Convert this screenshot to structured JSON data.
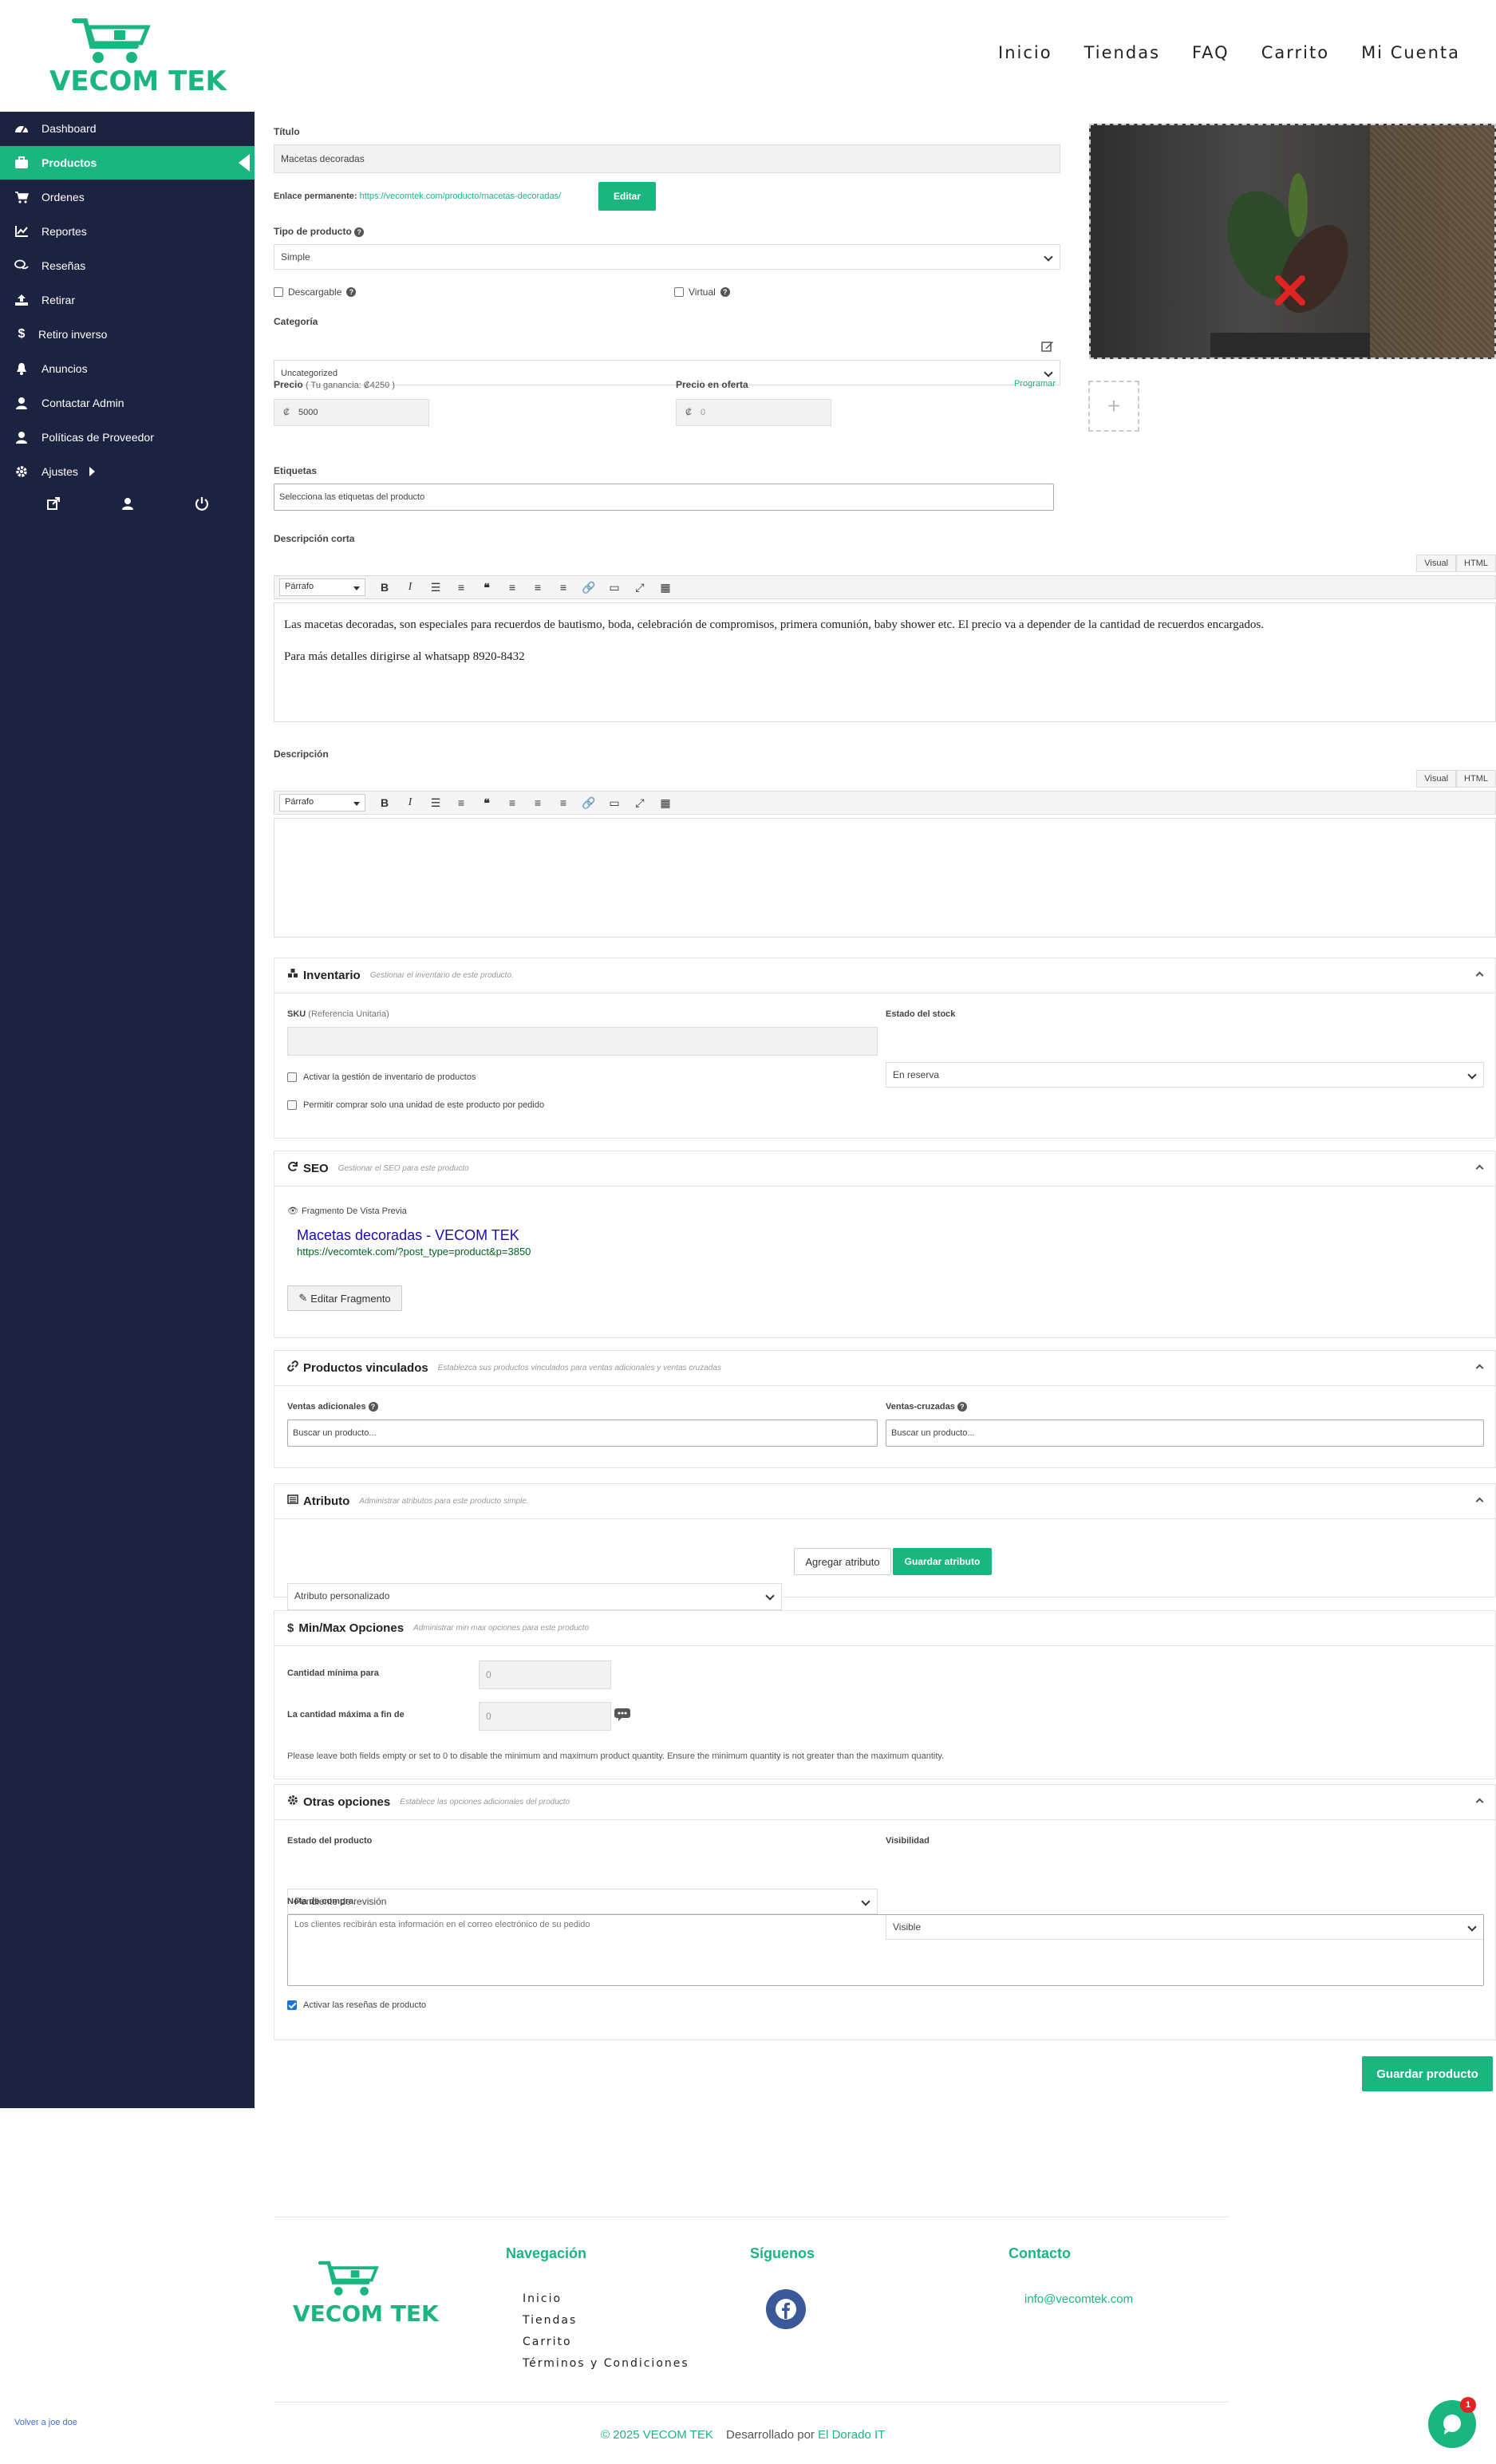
{
  "brand": {
    "name": "VECOM TEK",
    "color": "#1bb67f"
  },
  "topnav": [
    "Inicio",
    "Tiendas",
    "FAQ",
    "Carrito",
    "Mi Cuenta"
  ],
  "sidebar": {
    "items": [
      {
        "label": "Dashboard",
        "icon": "dashboard-icon"
      },
      {
        "label": "Productos",
        "icon": "briefcase-icon"
      },
      {
        "label": "Ordenes",
        "icon": "cart-icon"
      },
      {
        "label": "Reportes",
        "icon": "chart-icon"
      },
      {
        "label": "Reseñas",
        "icon": "comments-icon"
      },
      {
        "label": "Retirar",
        "icon": "upload-icon"
      },
      {
        "label": "Retiro inverso",
        "icon": "dollar-icon"
      },
      {
        "label": "Anuncios",
        "icon": "bell-icon"
      },
      {
        "label": "Contactar Admin",
        "icon": "user-icon"
      },
      {
        "label": "Políticas de Proveedor",
        "icon": "user-icon"
      },
      {
        "label": "Ajustes",
        "icon": "gear-icon"
      }
    ]
  },
  "form": {
    "titulo_label": "Título",
    "titulo_value": "Macetas decoradas",
    "permalink_label": "Enlace permanente:",
    "permalink_url": "https://vecomtek.com/producto/macetas-decoradas/",
    "edit_btn": "Editar",
    "tipo_label": "Tipo de producto",
    "tipo_value": "Simple",
    "descargable": "Descargable",
    "virtual": "Virtual",
    "categoria_label": "Categoría",
    "categoria_value": "Uncategorized",
    "precio_label": "Precio",
    "precio_ganancia": "( Tu ganancia: ₡4250 )",
    "precio_value": "5000",
    "currency": "₡",
    "oferta_label": "Precio en oferta",
    "oferta_placeholder": "0",
    "programar": "Programar",
    "etiquetas_label": "Etiquetas",
    "etiquetas_placeholder": "Selecciona las etiquetas del producto",
    "desc_corta_label": "Descripción corta",
    "desc_corta_p1": "Las macetas decoradas, son especiales para recuerdos de bautismo, boda, celebración de compromisos, primera comunión, baby shower etc. El precio va a depender de la cantidad de recuerdos encargados.",
    "desc_corta_p2": "Para más detalles dirigirse al whatsapp 8920-8432",
    "desc_label": "Descripción",
    "editor_tab_visual": "Visual",
    "editor_tab_html": "HTML",
    "editor_format": "Párrafo"
  },
  "inventario": {
    "title": "Inventario",
    "hint": "Gestionar el inventario de este producto.",
    "sku_label": "SKU",
    "sku_sub": "(Referencia Unitaria)",
    "stock_label": "Estado del stock",
    "stock_value": "En reserva",
    "check1": "Activar la gestión de inventario de productos",
    "check2": "Permitir comprar solo una unidad de este producto por pedido"
  },
  "seo": {
    "title": "SEO",
    "hint": "Gestionar el SEO para este producto",
    "preview_label": "Fragmento De Vista Previa",
    "preview_title": "Macetas decoradas - VECOM TEK",
    "preview_url": "https://vecomtek.com/?post_type=product&p=3850",
    "edit_btn": "Editar Fragmento"
  },
  "vinculados": {
    "title": "Productos vinculados",
    "hint": "Establezca sus productos vinculados para ventas adicionales y ventas cruzadas",
    "upsell_label": "Ventas adicionales",
    "cross_label": "Ventas-cruzadas",
    "placeholder": "Buscar un producto..."
  },
  "atributo": {
    "title": "Atributo",
    "hint": "Administrar atributos para este producto simple.",
    "select_value": "Atributo personalizado",
    "add_btn": "Agregar atributo",
    "save_btn": "Guardar atributo"
  },
  "minmax": {
    "title": "Min/Max Opciones",
    "hint": "Administrar min max opciones para este producto",
    "min_label": "Cantidad mínima para",
    "max_label": "La cantidad máxima a fin de",
    "min_placeholder": "0",
    "max_placeholder": "0",
    "note": "Please leave both fields empty or set to 0 to disable the minimum and maximum product quantity. Ensure the minimum quantity is not greater than the maximum quantity."
  },
  "otras": {
    "title": "Otras opciones",
    "hint": "Establece las opciones adicionales del producto",
    "estado_label": "Estado del producto",
    "estado_value": "Pendiente de revisión",
    "visibilidad_label": "Visibilidad",
    "visibilidad_value": "Visible",
    "nota_label": "Nota de compra",
    "nota_placeholder": "Los clientes recibirán esta información en el correo electrónico de su pedido",
    "reviews": "Activar las reseñas de producto"
  },
  "save_product": "Guardar producto",
  "footer": {
    "nav_title": "Navegación",
    "nav_links": [
      "Inicio",
      "Tiendas",
      "Carrito",
      "Términos y Condiciones"
    ],
    "follow_title": "Síguenos",
    "contact_title": "Contacto",
    "email": "info@vecomtek.com",
    "copyright": "© 2025 VECOM TEK",
    "dev_prefix": "Desarrollado por",
    "dev_name": "El Dorado IT",
    "switch_back": "Volver a joe doe",
    "chat_badge": "1"
  }
}
